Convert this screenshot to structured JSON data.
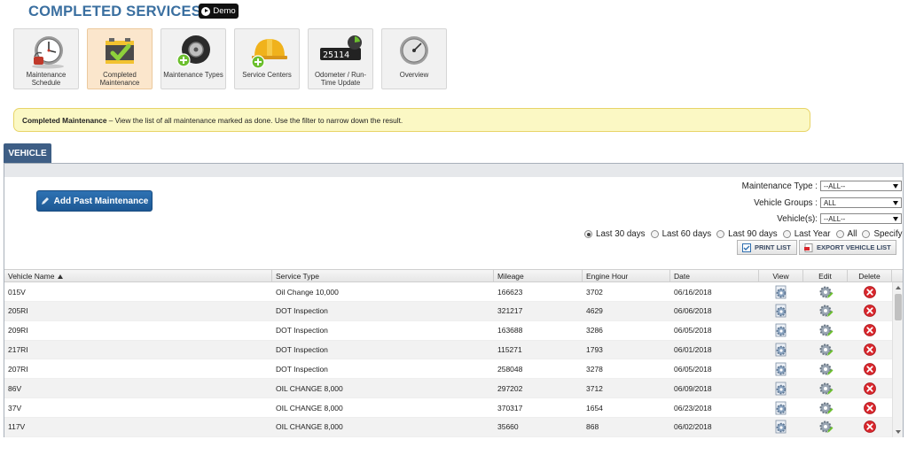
{
  "page": {
    "title": "COMPLETED SERVICES",
    "demo_label": "Demo"
  },
  "nav": {
    "items": [
      {
        "label": "Maintenance Schedule",
        "icon": "clock-icon"
      },
      {
        "label": "Completed Maintenance",
        "icon": "battery-check-icon"
      },
      {
        "label": "Maintenance Types",
        "icon": "tire-add-icon"
      },
      {
        "label": "Service Centers",
        "icon": "hardhat-add-icon"
      },
      {
        "label": "Odometer / Run-Time Update",
        "icon": "odometer-icon",
        "odometer_value": "25114"
      },
      {
        "label": "Overview",
        "icon": "gauge-icon"
      }
    ],
    "active_index": 1
  },
  "banner": {
    "title": "Completed Maintenance",
    "text": " – View the list of all maintenance marked as done. Use the filter to narrow down the result."
  },
  "tab": {
    "label": "VEHICLE"
  },
  "toolbar": {
    "add_label": "Add Past Maintenance",
    "print_label": "PRINT LIST",
    "export_label": "EXPORT VEHICLE LIST"
  },
  "filters": {
    "maintenance_type_label": "Maintenance Type :",
    "maintenance_type_value": "--ALL--",
    "vehicle_groups_label": "Vehicle Groups :",
    "vehicle_groups_value": "ALL",
    "vehicles_label": "Vehicle(s):",
    "vehicles_value": "--ALL--",
    "date_options": [
      "Last 30 days",
      "Last 60 days",
      "Last 90 days",
      "Last Year",
      "All",
      "Specify"
    ],
    "selected_date_option": 0
  },
  "table": {
    "headers": [
      "Vehicle Name",
      "Service Type",
      "Mileage",
      "Engine Hour",
      "Date",
      "View",
      "Edit",
      "Delete"
    ],
    "sorted_column": 0,
    "rows": [
      {
        "vehicle": "015V",
        "service": "Oil Change 10,000",
        "mileage": "166623",
        "engine_hour": "3702",
        "date": "06/16/2018"
      },
      {
        "vehicle": "205RI",
        "service": "DOT Inspection",
        "mileage": "321217",
        "engine_hour": "4629",
        "date": "06/06/2018"
      },
      {
        "vehicle": "209RI",
        "service": "DOT Inspection",
        "mileage": "163688",
        "engine_hour": "3286",
        "date": "06/05/2018"
      },
      {
        "vehicle": "217RI",
        "service": "DOT Inspection",
        "mileage": "115271",
        "engine_hour": "1793",
        "date": "06/01/2018"
      },
      {
        "vehicle": "207RI",
        "service": "DOT Inspection",
        "mileage": "258048",
        "engine_hour": "3278",
        "date": "06/05/2018"
      },
      {
        "vehicle": "86V",
        "service": "OIL CHANGE 8,000",
        "mileage": "297202",
        "engine_hour": "3712",
        "date": "06/09/2018"
      },
      {
        "vehicle": "37V",
        "service": "OIL CHANGE 8,000",
        "mileage": "370317",
        "engine_hour": "1654",
        "date": "06/23/2018"
      },
      {
        "vehicle": "117V",
        "service": "OIL CHANGE 8,000",
        "mileage": "35660",
        "engine_hour": "868",
        "date": "06/02/2018"
      }
    ]
  },
  "colors": {
    "title": "#3a6fa0",
    "tab": "#3e5e85",
    "primary_button": "#2568a8",
    "banner_bg": "#fbf8c4",
    "active_tile": "#fbe6cc",
    "delete": "#d9262c"
  }
}
